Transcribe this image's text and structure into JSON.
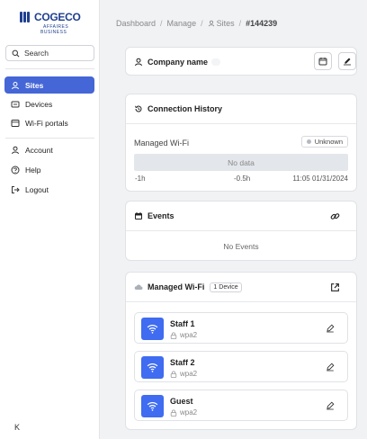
{
  "brand": {
    "name": "COGECO",
    "line1": "AFFAIRES",
    "line2": "BUSINESS",
    "color": "#1f3f8f"
  },
  "sidebar": {
    "search_label": "Search",
    "items": [
      {
        "label": "Sites",
        "icon": "user-location-icon",
        "active": true
      },
      {
        "label": "Devices",
        "icon": "device-icon"
      },
      {
        "label": "Wi-Fi portals",
        "icon": "portal-icon"
      },
      {
        "label": "Account",
        "icon": "user-icon"
      },
      {
        "label": "Help",
        "icon": "help-icon"
      },
      {
        "label": "Logout",
        "icon": "logout-icon"
      }
    ],
    "collapse_label": "K"
  },
  "breadcrumb": {
    "dashboard": "Dashboard",
    "manage": "Manage",
    "sites": "Sites",
    "current": "#144239",
    "separator": "/"
  },
  "company": {
    "title": "Company name"
  },
  "connection_history": {
    "title": "Connection History",
    "label": "Managed Wi-Fi",
    "status": "Unknown",
    "no_data": "No data",
    "ticks": [
      "-1h",
      "-0.5h",
      "11:05 01/31/2024"
    ]
  },
  "events": {
    "title": "Events",
    "empty": "No Events"
  },
  "managed_wifi": {
    "title": "Managed Wi-Fi",
    "badge": "1 Device",
    "networks": [
      {
        "name": "Staff 1",
        "security": "wpa2"
      },
      {
        "name": "Staff 2",
        "security": "wpa2"
      },
      {
        "name": "Guest",
        "security": "wpa2"
      }
    ]
  },
  "colors": {
    "accent": "#4566d6",
    "wifi_icon_bg": "#3f6cf0",
    "background": "#f1f2f4"
  }
}
